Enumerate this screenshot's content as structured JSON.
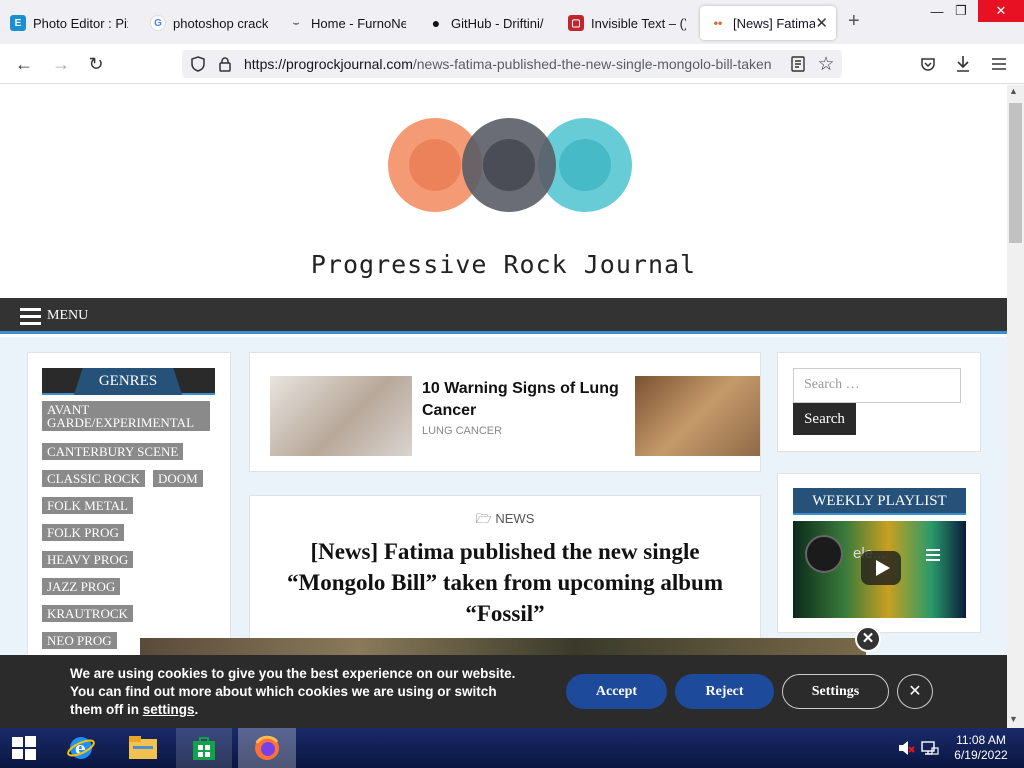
{
  "browser": {
    "tabs": [
      {
        "title": "Photo Editor : Pixlr",
        "favicon": "E",
        "fav_color": "#1b8fd0"
      },
      {
        "title": "photoshop crack -",
        "favicon": "G",
        "fav_color": "#fff"
      },
      {
        "title": "Home - FurnoNet",
        "favicon": "⌣",
        "fav_color": "#f0f0f4"
      },
      {
        "title": "GitHub - Driftini/",
        "favicon": "●",
        "fav_color": "#111"
      },
      {
        "title": "Invisible Text – () i",
        "favicon": "▢",
        "fav_color": "#c0262c"
      },
      {
        "title": "[News] Fatima |",
        "favicon": "••",
        "fav_color": "#fff"
      }
    ],
    "new_tab": "+",
    "url_domain": "https://progrockjournal.com",
    "url_path": "/news-fatima-published-the-new-single-mongolo-bill-taken"
  },
  "site": {
    "title": "Progressive Rock Journal",
    "menu_label": "MENU"
  },
  "sidebar": {
    "heading": "GENRES",
    "tags": [
      "AVANT GARDE/EXPERIMENTAL",
      "CANTERBURY SCENE",
      "CLASSIC ROCK",
      "DOOM",
      "FOLK METAL",
      "FOLK PROG",
      "HEAVY PROG",
      "JAZZ PROG",
      "KRAUTROCK",
      "NEO PROG"
    ]
  },
  "ad": {
    "title": "10 Warning Signs of Lung Cancer",
    "subtitle": "LUNG CANCER"
  },
  "post": {
    "category": "NEWS",
    "title": "[News] Fatima published the new single “Mongolo Bill” taken from upcoming album “Fossil”"
  },
  "right": {
    "search_placeholder": "Search …",
    "search_button": "Search",
    "playlist_heading": "WEEKLY PLAYLIST",
    "video_title": "ele..."
  },
  "cookie": {
    "text_1": "We are using cookies to give you the best experience on our website. You can find out more about which cookies we are using or switch them off in ",
    "link": "settings",
    "text_2": ".",
    "accept": "Accept",
    "reject": "Reject",
    "settings": "Settings",
    "close": "✕"
  },
  "taskbar": {
    "time": "11:08 AM",
    "date": "6/19/2022"
  },
  "colors": {
    "accent_blue": "#3a8fd0",
    "nav_dark": "#333333",
    "cookie_button": "#1d4a9a"
  }
}
